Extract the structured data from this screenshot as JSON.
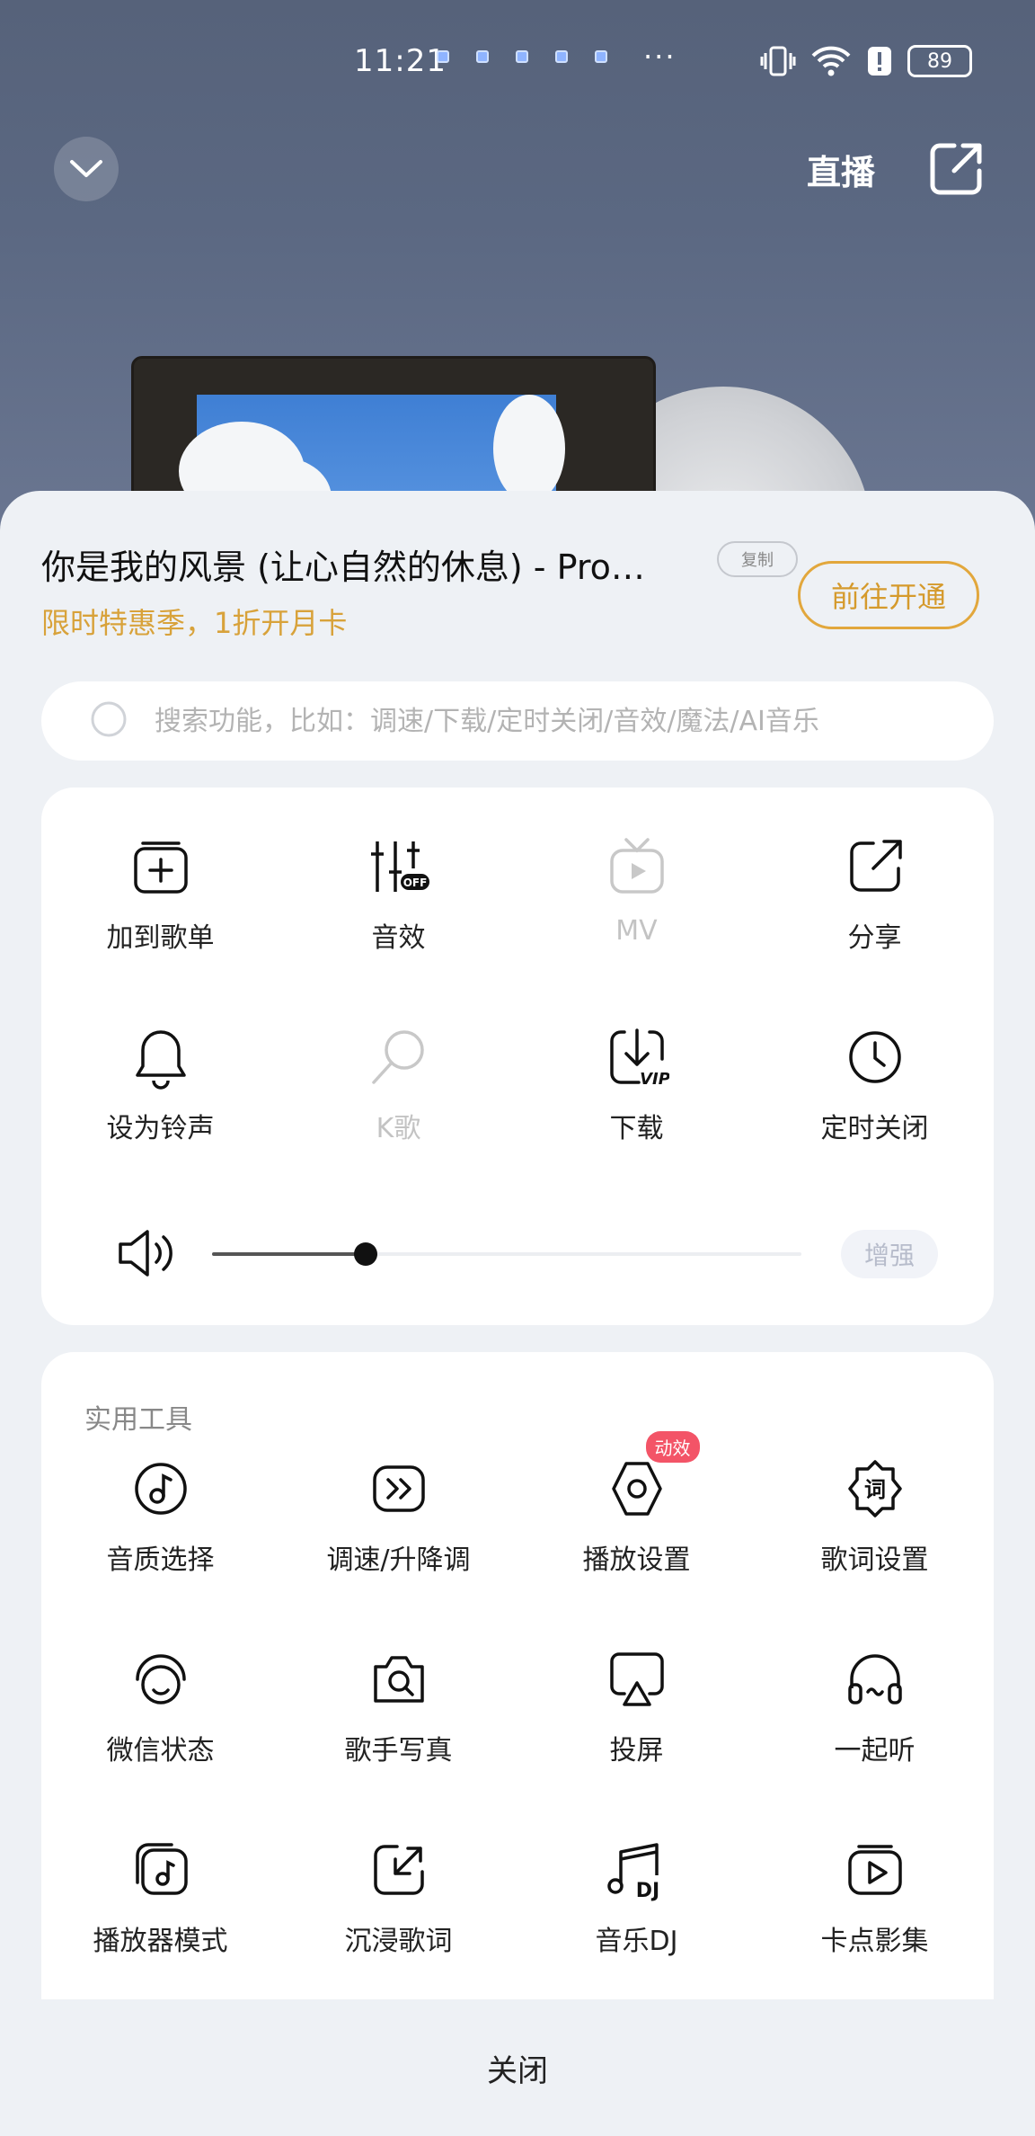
{
  "status_bar": {
    "time": "11:21",
    "more": "···",
    "battery": "89"
  },
  "header": {
    "live_label": "直播"
  },
  "song": {
    "title": "你是我的风景 (让心自然的休息) - Pro…",
    "copy_label": "复制",
    "promo": "限时特惠季，1折开月卡",
    "open_label": "前往开通"
  },
  "search": {
    "placeholder": "搜索功能，比如：调速/下载/定时关闭/音效/魔法/AI音乐"
  },
  "main_grid": [
    {
      "label": "加到歌单",
      "icon": "add-to-playlist-icon"
    },
    {
      "label": "音效",
      "icon": "sound-effect-icon"
    },
    {
      "label": "MV",
      "icon": "mv-icon"
    },
    {
      "label": "分享",
      "icon": "share-icon"
    },
    {
      "label": "设为铃声",
      "icon": "bell-icon"
    },
    {
      "label": "K歌",
      "icon": "karaoke-mic-icon"
    },
    {
      "label": "下载",
      "icon": "download-vip-icon"
    },
    {
      "label": "定时关闭",
      "icon": "clock-icon"
    }
  ],
  "volume": {
    "level": 0.26,
    "boost_label": "增强"
  },
  "tools": {
    "title": "实用工具",
    "badge": "动效",
    "items": [
      {
        "label": "音质选择",
        "icon": "sound-quality-icon"
      },
      {
        "label": "调速/升降调",
        "icon": "speed-icon"
      },
      {
        "label": "播放设置",
        "icon": "play-settings-icon"
      },
      {
        "label": "歌词设置",
        "icon": "lyrics-settings-icon"
      },
      {
        "label": "微信状态",
        "icon": "wechat-status-icon"
      },
      {
        "label": "歌手写真",
        "icon": "singer-photo-icon"
      },
      {
        "label": "投屏",
        "icon": "cast-icon"
      },
      {
        "label": "一起听",
        "icon": "listen-together-icon"
      },
      {
        "label": "播放器模式",
        "icon": "player-mode-icon"
      },
      {
        "label": "沉浸歌词",
        "icon": "immersive-lyrics-icon"
      },
      {
        "label": "音乐DJ",
        "icon": "music-dj-icon"
      },
      {
        "label": "卡点影集",
        "icon": "video-album-icon"
      }
    ]
  },
  "footer": {
    "close_label": "关闭"
  }
}
